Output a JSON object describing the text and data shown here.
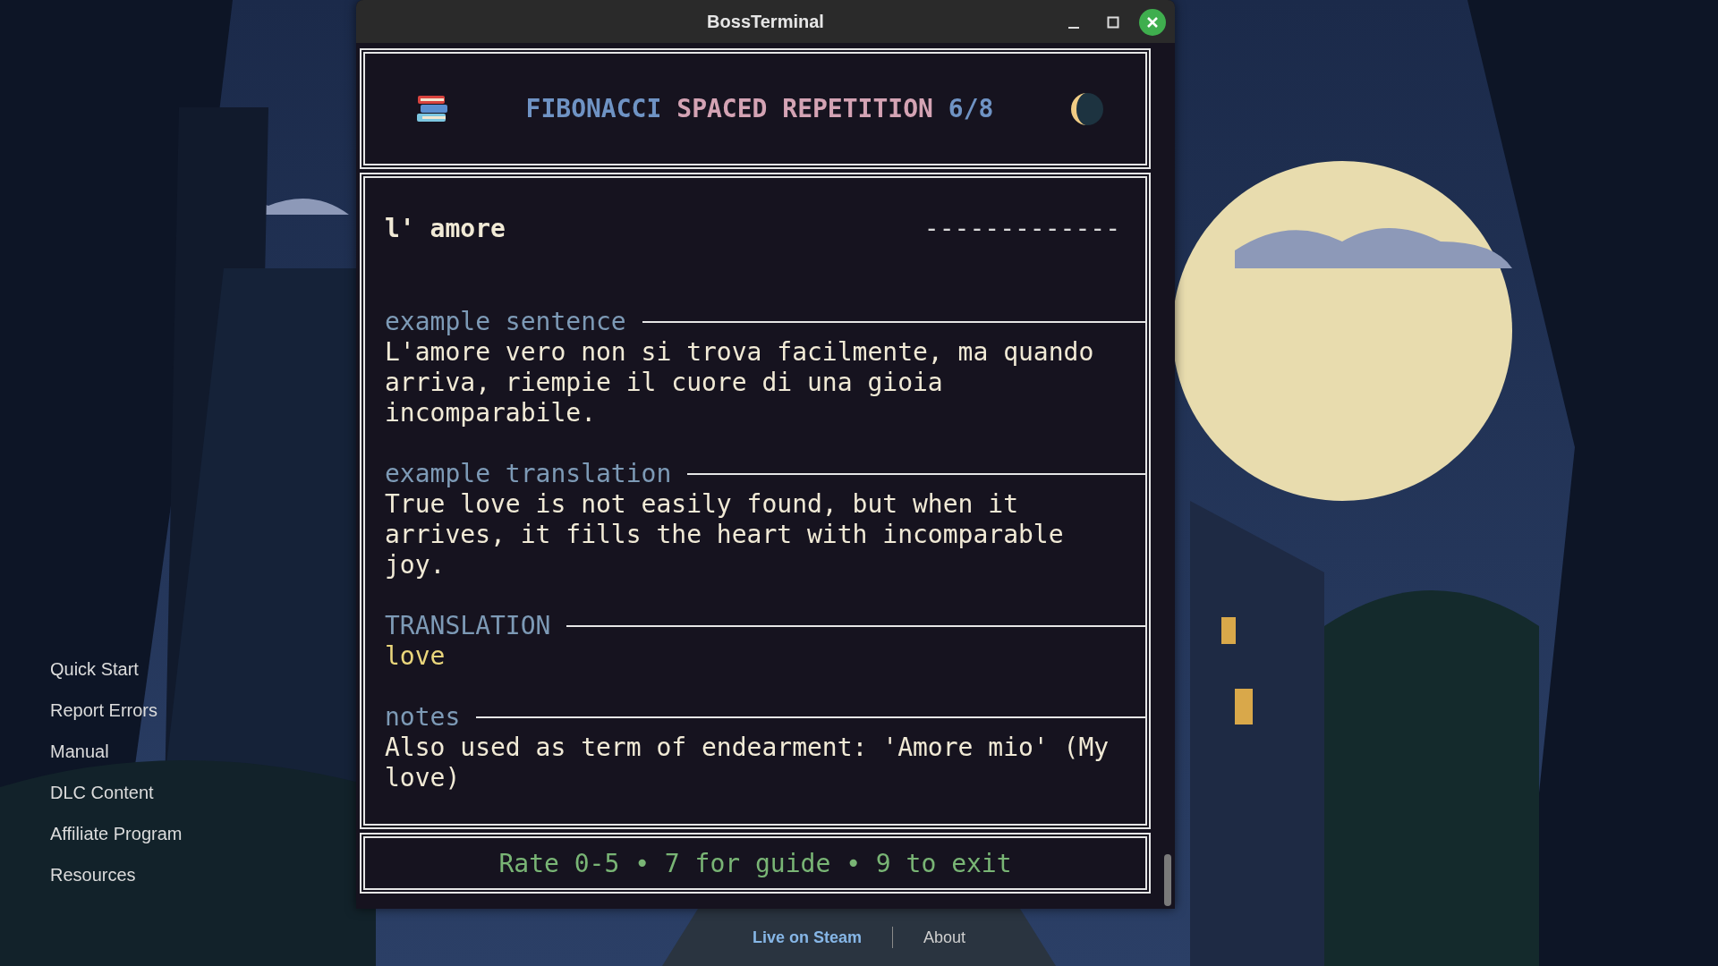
{
  "window": {
    "title": "BossTerminal"
  },
  "sidebar": {
    "items": [
      {
        "label": "Quick Start"
      },
      {
        "label": "Report Errors"
      },
      {
        "label": "Manual"
      },
      {
        "label": "DLC Content"
      },
      {
        "label": "Affiliate Program"
      },
      {
        "label": "Resources"
      }
    ]
  },
  "card": {
    "title_parts": [
      {
        "text": "FIBONACCI",
        "color": "#6f93c4"
      },
      {
        "text": "SPACED REPETITION",
        "color": "#d4a3b4"
      },
      {
        "text": "6/8",
        "color": "#6f93c4"
      }
    ],
    "term": "l' amore",
    "answer_mask": "-------------",
    "sections": [
      {
        "heading": "example sentence",
        "kind": "plain",
        "body": "L'amore vero non si trova facilmente, ma quando arriva, riempie il cuore di una gioia incomparabile."
      },
      {
        "heading": "example translation",
        "kind": "plain",
        "body": "True love is not easily found, but when it arrives, it fills the heart with incomparable joy."
      },
      {
        "heading": "TRANSLATION",
        "kind": "answer",
        "body": "love"
      },
      {
        "heading": "notes",
        "kind": "plain",
        "body": "Also used as term of endearment: 'Amore mio' (My love)"
      }
    ],
    "hint": "Rate 0-5 • 7 for guide • 9 to exit"
  },
  "footer": {
    "links": [
      {
        "label": "Live on Steam",
        "kind": "highlight"
      },
      {
        "label": "About",
        "kind": "plain"
      }
    ]
  }
}
